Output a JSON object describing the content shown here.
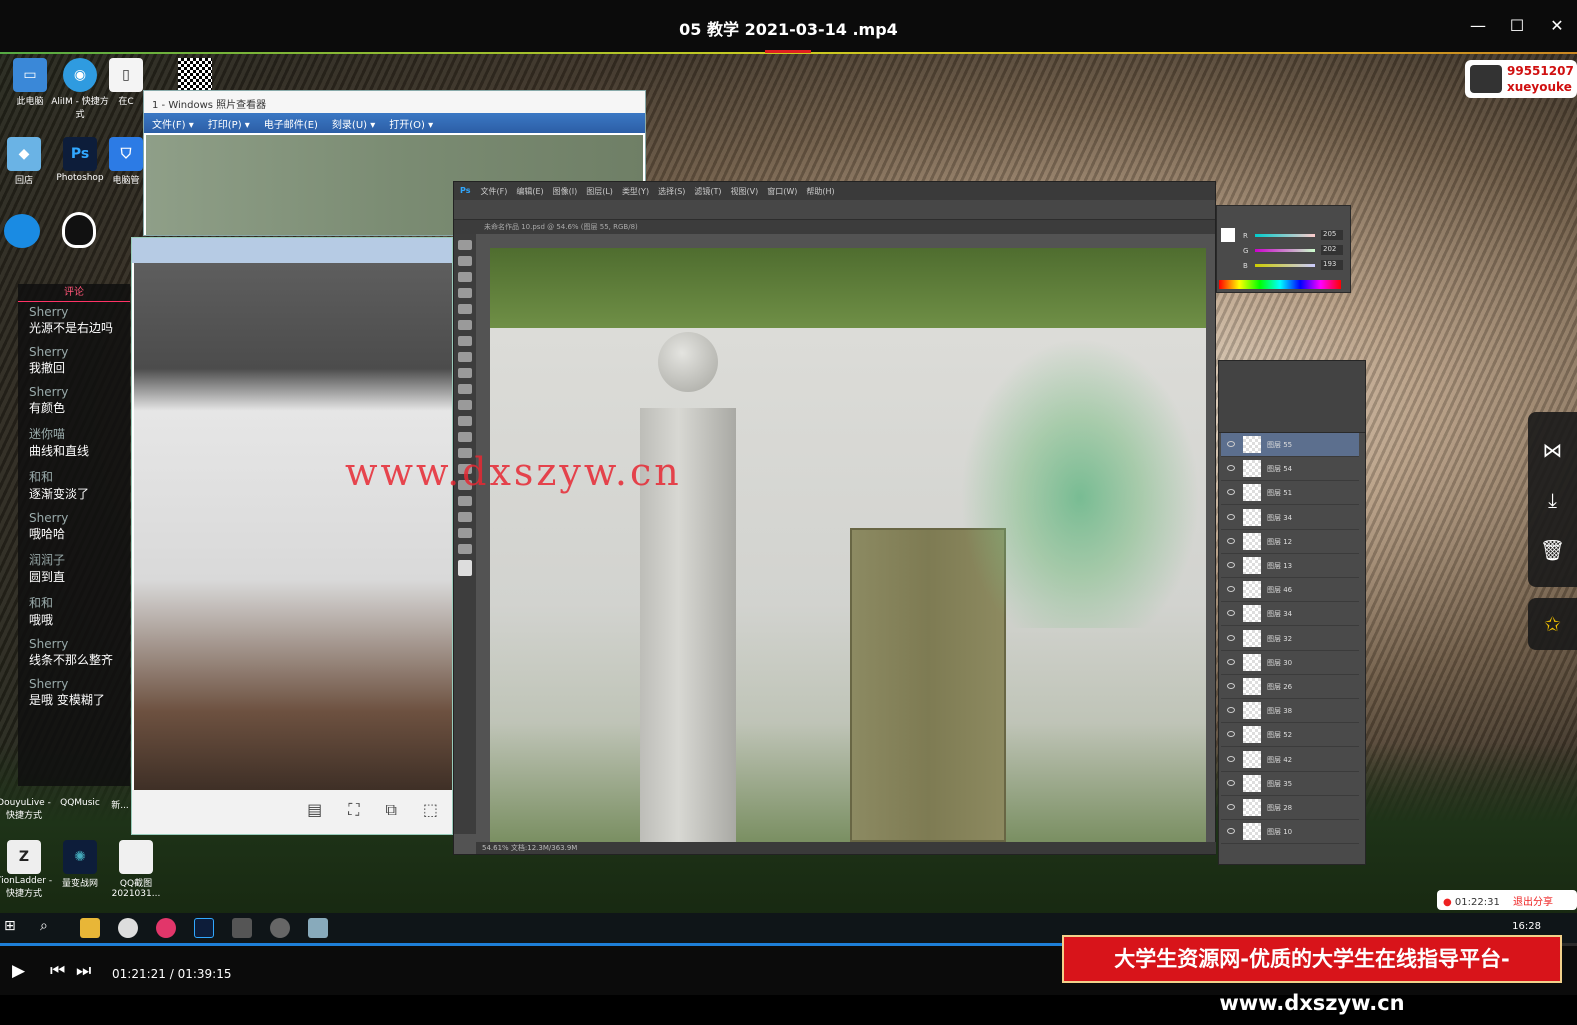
{
  "player": {
    "title": "05 教学 2021-03-14 .mp4",
    "time_current": "01:21:21",
    "time_separator": " / ",
    "time_total": "01:39:15",
    "progress_fraction": 0.82
  },
  "desktop": {
    "icons": [
      {
        "label": "此电脑"
      },
      {
        "label": "AliIM - 快捷方式"
      },
      {
        "label": "在C"
      },
      {
        "label": "回店"
      },
      {
        "label": "Photoshop"
      },
      {
        "label": "电脑管"
      }
    ],
    "bottom_icons": [
      {
        "label": "DouyuLive - 快捷方式"
      },
      {
        "label": "QQMusic"
      },
      {
        "label": "新..."
      },
      {
        "label": "TionLadder - 快捷方式"
      },
      {
        "label": "量变战网"
      },
      {
        "label": "QQ截图 2021031..."
      }
    ]
  },
  "photo_viewer": {
    "title": "1 - Windows 照片查看器",
    "menu": [
      "文件(F) ▾",
      "打印(P) ▾",
      "电子邮件(E)",
      "刻录(U) ▾",
      "打开(O) ▾"
    ]
  },
  "chat": {
    "header": "评论",
    "messages": [
      {
        "name": "Sherry",
        "text": "光源不是右边吗"
      },
      {
        "name": "Sherry",
        "text": "我撤回"
      },
      {
        "name": "Sherry",
        "text": "有颜色"
      },
      {
        "name": "迷你喵",
        "text": "曲线和直线"
      },
      {
        "name": "和和",
        "text": "逐渐变淡了"
      },
      {
        "name": "Sherry",
        "text": "哦哈哈"
      },
      {
        "name": "润润子",
        "text": "圆到直"
      },
      {
        "name": "和和",
        "text": "哦哦"
      },
      {
        "name": "Sherry",
        "text": "线条不那么整齐"
      },
      {
        "name": "Sherry",
        "text": "是哦 变模糊了"
      }
    ]
  },
  "photoshop": {
    "logo": "Ps",
    "menu": [
      "文件(F)",
      "编辑(E)",
      "图像(I)",
      "图层(L)",
      "类型(Y)",
      "选择(S)",
      "滤镜(T)",
      "视图(V)",
      "窗口(W)",
      "帮助(H)"
    ],
    "doc_tab": "未命名作品 10.psd @ 54.6% (图层 55, RGB/8)",
    "status": "54.61%   文档:12.3M/363.9M",
    "layers": [
      "图层 55",
      "图层 54",
      "图层 51",
      "图层 34",
      "图层 12",
      "图层 13",
      "图层 46",
      "图层 34",
      "图层 32",
      "图层 30",
      "图层 26",
      "图层 38",
      "图层 52",
      "图层 42",
      "图层 35",
      "图层 28",
      "图层 10"
    ],
    "color_values": {
      "r": "205",
      "g": "202",
      "b": "193"
    }
  },
  "watermark": "www.dxszyw.cn",
  "id_badge": {
    "line1": "99551207",
    "line2": "xueyouke"
  },
  "recording": {
    "time": "01:22:31",
    "action": "退出分享"
  },
  "taskbar": {
    "clock": "16:28"
  },
  "banner": "大学生资源网-优质的大学生在线指导平台-www.dxszyw.cn",
  "icons": {
    "minimize": "minimize-icon",
    "maximize": "maximize-icon",
    "close": "close-icon",
    "share": "share-icon",
    "download": "download-icon",
    "delete": "trash-icon",
    "pin": "pin-icon",
    "play": "play-icon",
    "prev": "skip-back-icon",
    "next": "skip-forward-icon"
  }
}
